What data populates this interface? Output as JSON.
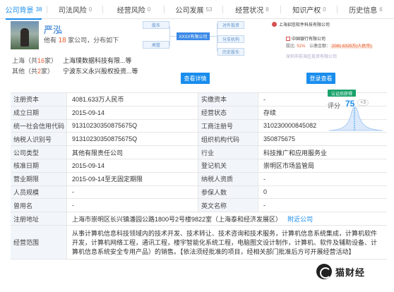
{
  "tabs": [
    {
      "label": "公司背景",
      "count": "38",
      "active": true
    },
    {
      "label": "司法风险",
      "count": "0",
      "active": false
    },
    {
      "label": "经营风险",
      "count": "0",
      "active": false
    },
    {
      "label": "公司发展",
      "count": "53",
      "active": false
    },
    {
      "label": "经营状况",
      "count": "8",
      "active": false
    },
    {
      "label": "知识产权",
      "count": "0",
      "active": false
    },
    {
      "label": "历史信息",
      "count": "6",
      "active": false
    }
  ],
  "person": {
    "name": "严泓",
    "info_prefix": "他有",
    "info_count": "18",
    "info_suffix": "家公司，分布如下",
    "rows": [
      {
        "region": "上海",
        "count_pre": "（共",
        "count": "16",
        "count_post": "家）",
        "company": "上海璞数据科技有限...等"
      },
      {
        "region": "其他",
        "count_pre": "（共",
        "count": "2",
        "count_post": "家）",
        "company": "宁波东义永兴股权投资...等"
      }
    ]
  },
  "diagram": {
    "nodes": {
      "left_top": "股东",
      "left_bottom": "高管",
      "center": "XXXX有限公司",
      "right_top": "对外投资",
      "right_mid": "分支机构",
      "right_bottom": "历史股东"
    },
    "button": "查看详情"
  },
  "preview": {
    "company": "上海招信软件科技有限公司",
    "row1": "中国银行有限公司",
    "row2_pct": "51%",
    "row2_label": "认缴金额：",
    "row2_amt": "2081.6325万(人民币)",
    "row3": "深圳市前海区投资有限公司",
    "button": "登录查看"
  },
  "score": {
    "badge": "认证后获得",
    "label": "评分",
    "value": "75",
    "delta": "+3"
  },
  "table": {
    "rows": [
      {
        "l1": "注册资本",
        "v1": "4081.633万人民币",
        "l2": "实缴资本",
        "v2": "-"
      },
      {
        "l1": "成立日期",
        "v1": "2015-09-14",
        "l2": "经营状态",
        "v2": "存续"
      },
      {
        "l1": "统一社会信用代码",
        "v1": "91310230350875675Q",
        "l2": "工商注册号",
        "v2": "310230000845082"
      },
      {
        "l1": "纳税人识别号",
        "v1": "91310230350875675Q",
        "l2": "组织机构代码",
        "v2": "350875675"
      },
      {
        "l1": "公司类型",
        "v1": "其他有限责任公司",
        "l2": "行业",
        "v2": "科技推广和应用服务业"
      },
      {
        "l1": "核准日期",
        "v1": "2015-09-14",
        "l2": "登记机关",
        "v2": "崇明区市场监管局"
      },
      {
        "l1": "营业期限",
        "v1": "2015-09-14至无固定期限",
        "l2": "纳税人资质",
        "v2": "-"
      },
      {
        "l1": "人员规模",
        "v1": "-",
        "l2": "参保人数",
        "v2": "0"
      },
      {
        "l1": "曾用名",
        "v1": "-",
        "l2": "英文名称",
        "v2": "-"
      }
    ],
    "address_label": "注册地址",
    "address": "上海市崇明区长兴镇潘园公路1800号2号楼9822室（上海泰和经济发展区）",
    "address_link": "附近公司",
    "scope_label": "经营范围",
    "scope": "从事计算机信息科技领域内的技术开发、技术转让、技术咨询和技术服务，计算机信息系统集成，计算机软件开发，计算机网络工程，通讯工程，楼宇智能化系统工程，电脑图文设计制作，计算机、软件及辅助设备、计算机信息系统安全专用产品）的销售。【依法须经批准的项目，经相关部门批准后方可开展经营活动】"
  },
  "watermark": {
    "text": "猫财经"
  },
  "colors": {
    "accent": "#1a8ded",
    "highlight": "#e85a2a",
    "label_bg": "#f2f6fb",
    "badge": "#1aa36b"
  }
}
